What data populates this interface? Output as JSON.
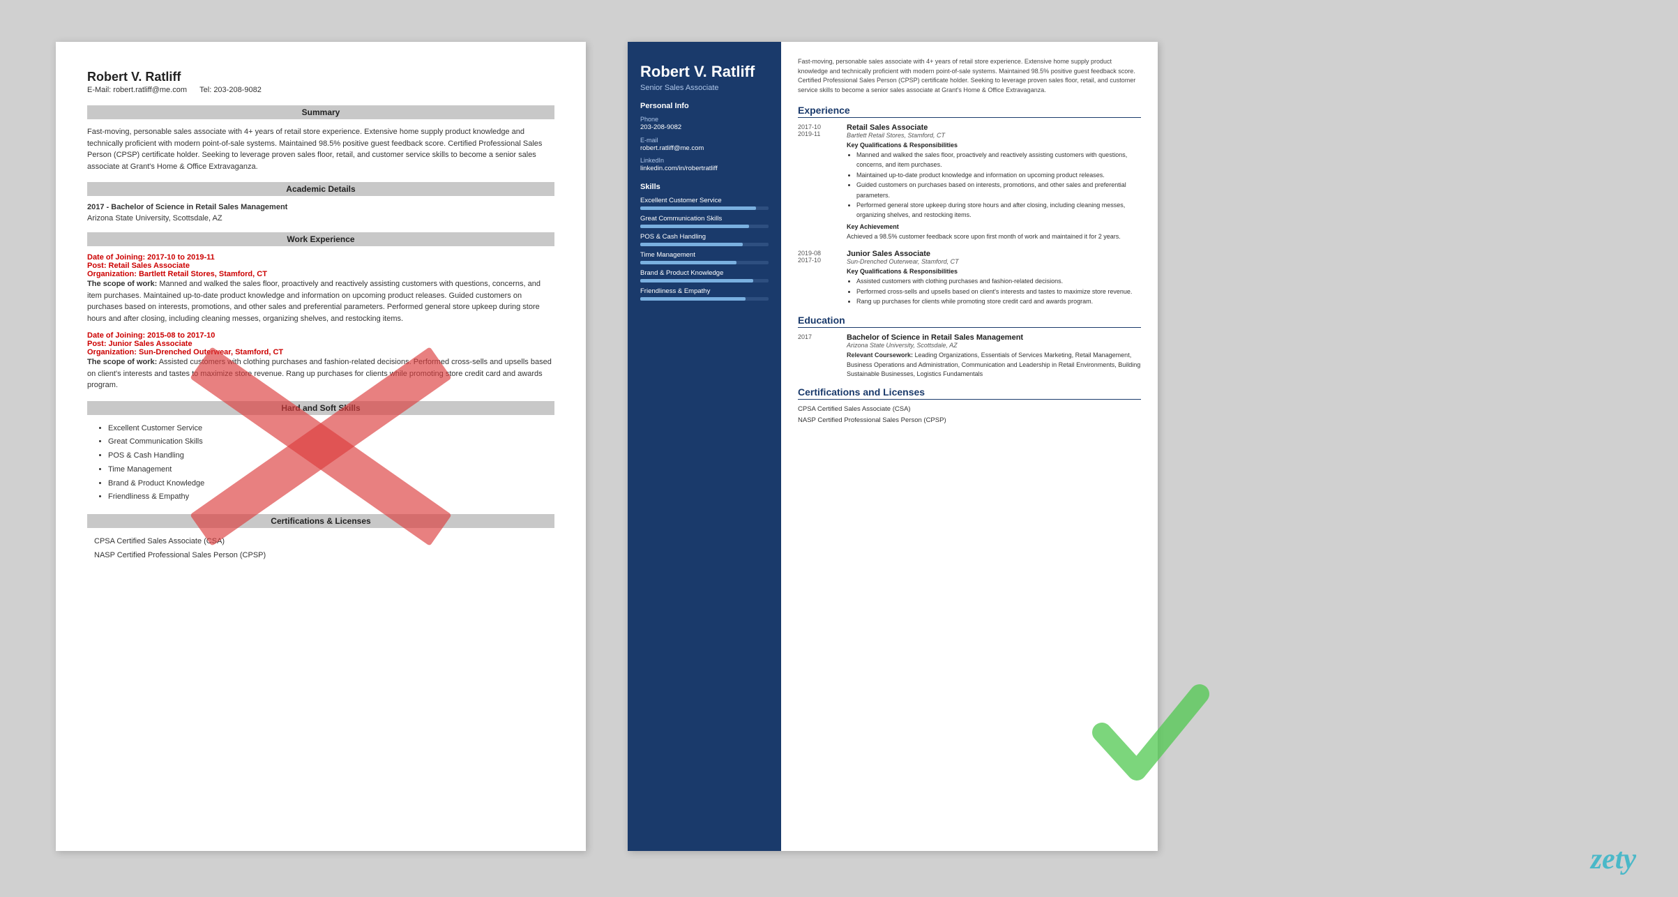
{
  "left_resume": {
    "name": "Robert V. Ratliff",
    "email": "E-Mail: robert.ratliff@me.com",
    "phone": "Tel: 203-208-9082",
    "sections": {
      "summary_title": "Summary",
      "summary_text": "Fast-moving, personable sales associate with 4+ years of retail store experience. Extensive home supply product knowledge and technically proficient with modern point-of-sale systems. Maintained 98.5% positive guest feedback score. Certified Professional Sales Person (CPSP) certificate holder. Seeking to leverage proven sales floor, retail, and customer service skills to become a senior sales associate at Grant's Home & Office Extravaganza.",
      "academic_title": "Academic Details",
      "degree": "2017 - Bachelor of Science in Retail Sales Management",
      "school": "Arizona State University, Scottsdale, AZ",
      "work_title": "Work Experience",
      "work1_date": "Date of Joining: 2017-10 to 2019-11",
      "work1_post": "Post: Retail Sales Associate",
      "work1_org": "Organization: Bartlett Retail Stores, Stamford, CT",
      "work1_scope_label": "The scope of work:",
      "work1_scope": "Manned and walked the sales floor, proactively and reactively assisting customers with questions, concerns, and item purchases. Maintained up-to-date product knowledge and information on upcoming product releases. Guided customers on purchases based on interests, promotions, and other sales and preferential parameters. Performed general store upkeep during store hours and after closing, including cleaning messes, organizing shelves, and restocking items.",
      "work2_date": "Date of Joining: 2015-08 to 2017-10",
      "work2_post": "Post: Junior Sales Associate",
      "work2_org": "Organization: Sun-Drenched Outerwear, Stamford, CT",
      "work2_scope_label": "The scope of work:",
      "work2_scope": "Assisted customers with clothing purchases and fashion-related decisions. Performed cross-sells and upsells based on client's interests and tastes to maximize store revenue. Rang up purchases for clients while promoting store credit card and awards program.",
      "skills_title": "Hard and Soft Skills",
      "skills": [
        "Excellent Customer Service",
        "Great Communication Skills",
        "POS & Cash Handling",
        "Time Management",
        "Brand & Product Knowledge",
        "Friendliness & Empathy"
      ],
      "cert_title": "Certifications & Licenses",
      "certs": [
        "CPSA Certified Sales Associate (CSA)",
        "NASP Certified Professional Sales Person (CPSP)"
      ]
    }
  },
  "right_resume": {
    "name": "Robert V. Ratliff",
    "title": "Senior Sales Associate",
    "personal_info_title": "Personal Info",
    "phone_label": "Phone",
    "phone": "203-208-9082",
    "email_label": "E-mail",
    "email": "robert.ratliff@me.com",
    "linkedin_label": "LinkedIn",
    "linkedin": "linkedin.com/in/robertratliff",
    "skills_title": "Skills",
    "skills": [
      {
        "name": "Excellent Customer Service",
        "pct": 90
      },
      {
        "name": "Great Communication Skills",
        "pct": 85
      },
      {
        "name": "POS & Cash Handling",
        "pct": 80
      },
      {
        "name": "Time Management",
        "pct": 75
      },
      {
        "name": "Brand & Product Knowledge",
        "pct": 88
      },
      {
        "name": "Friendliness & Empathy",
        "pct": 82
      }
    ],
    "summary": "Fast-moving, personable sales associate with 4+ years of retail store experience. Extensive home supply product knowledge and technically proficient with modern point-of-sale systems. Maintained 98.5% positive guest feedback score. Certified Professional Sales Person (CPSP) certificate holder. Seeking to leverage proven sales floor, retail, and customer service skills to become a senior sales associate at Grant's Home & Office Extravaganza.",
    "experience_title": "Experience",
    "experience": [
      {
        "date_start": "2017-10",
        "date_end": "2019-11",
        "title": "Retail Sales Associate",
        "company": "Bartlett Retail Stores, Stamford, CT",
        "kq_label": "Key Qualifications & Responsibilities",
        "bullets": [
          "Manned and walked the sales floor, proactively and reactively assisting customers with questions, concerns, and item purchases.",
          "Maintained up-to-date product knowledge and information on upcoming product releases.",
          "Guided customers on purchases based on interests, promotions, and other sales and preferential parameters.",
          "Performed general store upkeep during store hours and after closing, including cleaning messes, organizing shelves, and restocking items."
        ],
        "achievement_label": "Key Achievement",
        "achievement": "Achieved a 98.5% customer feedback score upon first month of work and maintained it for 2 years."
      },
      {
        "date_start": "2019-08",
        "date_end": "2017-10",
        "title": "Junior Sales Associate",
        "company": "Sun-Drenched Outerwear, Stamford, CT",
        "kq_label": "Key Qualifications & Responsibilities",
        "bullets": [
          "Assisted customers with clothing purchases and fashion-related decisions.",
          "Performed cross-sells and upsells based on client's interests and tastes to maximize store revenue.",
          "Rang up purchases for clients while promoting store credit card and awards program."
        ]
      }
    ],
    "education_title": "Education",
    "education": [
      {
        "year": "2017",
        "degree": "Bachelor of Science in Retail Sales Management",
        "school": "Arizona State University, Scottsdale, AZ",
        "coursework_label": "Relevant Coursework:",
        "coursework": "Leading Organizations, Essentials of Services Marketing, Retail Management, Business Operations and Administration, Communication and Leadership in Retail Environments, Building Sustainable Businesses, Logistics Fundamentals"
      }
    ],
    "cert_title": "Certifications and Licenses",
    "certs": [
      "CPSA Certified Sales Associate (CSA)",
      "NASP Certified Professional Sales Person (CPSP)"
    ]
  },
  "branding": {
    "zety_label": "zety"
  }
}
